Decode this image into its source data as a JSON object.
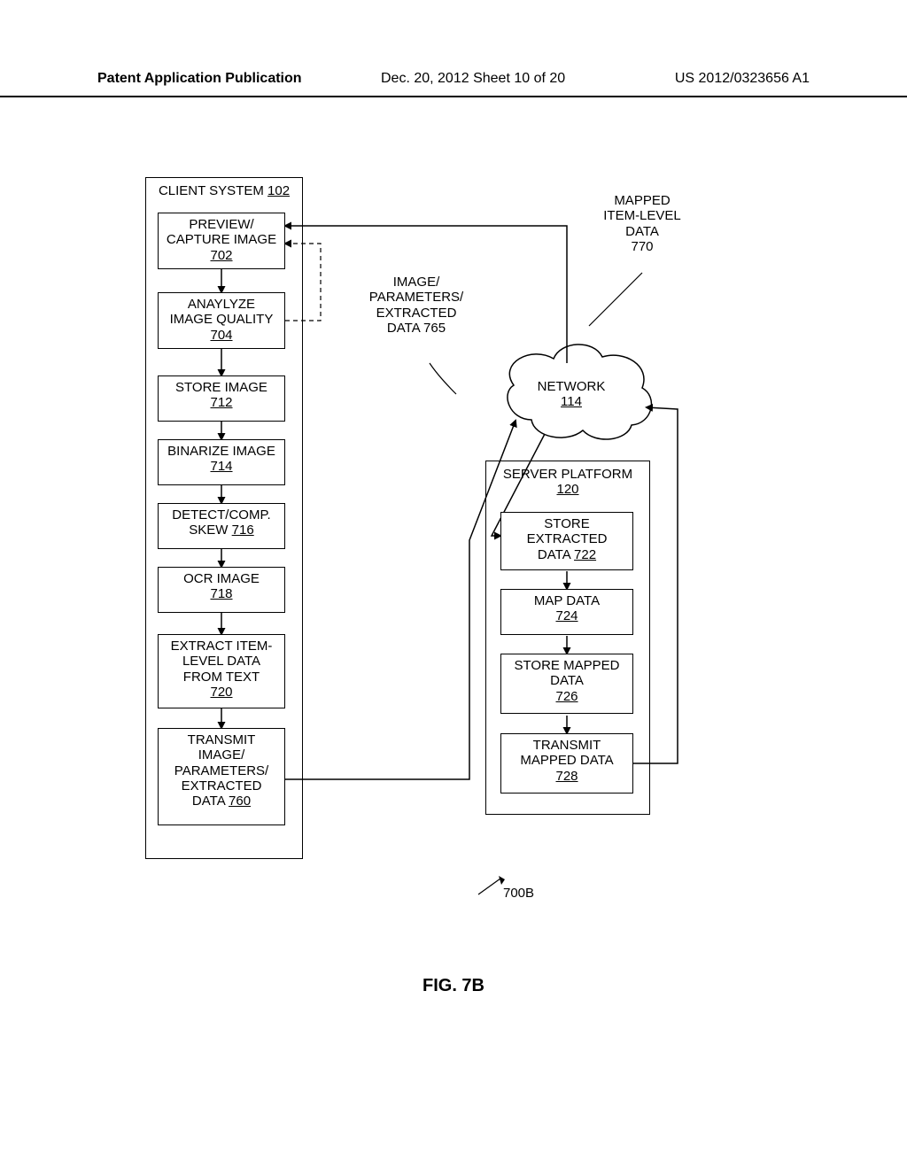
{
  "header": {
    "left": "Patent Application Publication",
    "mid": "Dec. 20, 2012  Sheet 10 of 20",
    "right": "US 2012/0323656 A1"
  },
  "figure_label": "FIG. 7B",
  "diagram_ref": "700B",
  "client": {
    "title": "CLIENT SYSTEM",
    "ref": "102",
    "steps": {
      "preview": {
        "text": "PREVIEW/\nCAPTURE IMAGE",
        "ref": "702"
      },
      "analyze": {
        "text": "ANAYLYZE\nIMAGE QUALITY",
        "ref": "704"
      },
      "store": {
        "text": "STORE IMAGE",
        "ref": "712"
      },
      "binarize": {
        "text": "BINARIZE IMAGE",
        "ref": "714"
      },
      "skew": {
        "text": "DETECT/COMP.\nSKEW",
        "ref_inline": "716"
      },
      "ocr": {
        "text": "OCR IMAGE",
        "ref": "718"
      },
      "extract": {
        "text": "EXTRACT ITEM-\nLEVEL DATA\nFROM TEXT",
        "ref": "720"
      },
      "transmit": {
        "text": "TRANSMIT\nIMAGE/\nPARAMETERS/\nEXTRACTED\nDATA",
        "ref_inline": "760"
      }
    }
  },
  "server": {
    "title": "SERVER PLATFORM",
    "ref": "120",
    "steps": {
      "store_ext": {
        "text": "STORE\nEXTRACTED\nDATA",
        "ref_inline": "722"
      },
      "map": {
        "text": "MAP DATA",
        "ref": "724"
      },
      "store_mapped": {
        "text": "STORE MAPPED\nDATA",
        "ref": "726"
      },
      "transmit": {
        "text": "TRANSMIT\nMAPPED DATA",
        "ref": "728"
      }
    }
  },
  "network": {
    "title": "NETWORK",
    "ref": "114"
  },
  "labels": {
    "image_params": {
      "text": "IMAGE/\nPARAMETERS/\nEXTRACTED\nDATA 765"
    },
    "mapped_item": {
      "text": "MAPPED\nITEM-LEVEL\nDATA\n770"
    }
  }
}
